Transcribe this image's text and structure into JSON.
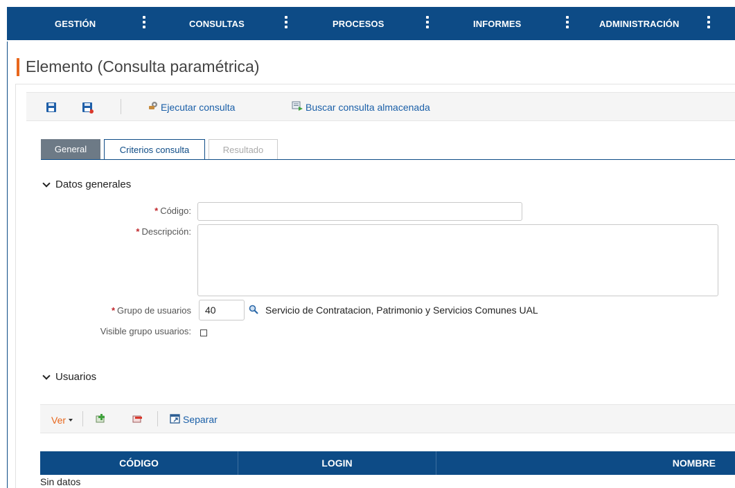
{
  "nav": {
    "items": [
      "GESTIÓN",
      "CONSULTAS",
      "PROCESOS",
      "INFORMES",
      "ADMINISTRACIÓN"
    ]
  },
  "page": {
    "title": "Elemento (Consulta paramétrica)"
  },
  "toolbar": {
    "run_query": "Ejecutar consulta",
    "search_stored": "Buscar consulta almacenada"
  },
  "tabs": [
    "General",
    "Criterios consulta",
    "Resultado"
  ],
  "general_section": {
    "title": "Datos generales",
    "required_mark": "*",
    "code_label": "Código:",
    "code_value": "",
    "description_label": "Descripción:",
    "description_value": "",
    "group_label": "Grupo de usuarios",
    "group_value": "40",
    "group_description": "Servicio de Contratacion, Patrimonio y Servicios Comunes UAL",
    "visible_label": "Visible grupo usuarios:"
  },
  "users_section": {
    "title": "Usuarios",
    "view_menu": "Ver",
    "detach": "Separar",
    "columns": [
      "CÓDIGO",
      "LOGIN",
      "NOMBRE"
    ],
    "empty_text": "Sin datos"
  },
  "colors": {
    "nav_bg": "#0d4b86",
    "accent": "#e8671c",
    "link": "#1a5fa8",
    "required": "#c0282d"
  }
}
